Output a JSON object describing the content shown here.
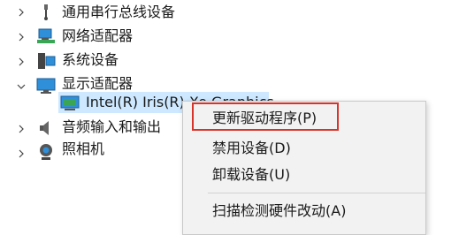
{
  "tree": {
    "items": [
      {
        "label": "通用串行总线设备",
        "expanded": false,
        "icon": "usb-icon"
      },
      {
        "label": "网络适配器",
        "expanded": false,
        "icon": "network-adapter-icon"
      },
      {
        "label": "系统设备",
        "expanded": false,
        "icon": "system-device-icon"
      },
      {
        "label": "显示适配器",
        "expanded": true,
        "icon": "display-adapter-icon"
      },
      {
        "label": "Intel(R) Iris(R) Xe Graphics",
        "selected": true,
        "icon": "display-device-icon"
      },
      {
        "label": "音频输入和输出",
        "expanded": false,
        "icon": "audio-icon"
      },
      {
        "label": "照相机",
        "expanded": false,
        "icon": "camera-icon"
      }
    ]
  },
  "context_menu": {
    "items": [
      {
        "label": "更新驱动程序(P)",
        "highlighted": true
      },
      {
        "label": "禁用设备(D)"
      },
      {
        "label": "卸载设备(U)"
      },
      {
        "label": "扫描检测硬件改动(A)"
      }
    ]
  },
  "colors": {
    "selection": "#cde8ff",
    "highlight_border": "#d9342b",
    "menu_bg": "#f2f2f2"
  }
}
